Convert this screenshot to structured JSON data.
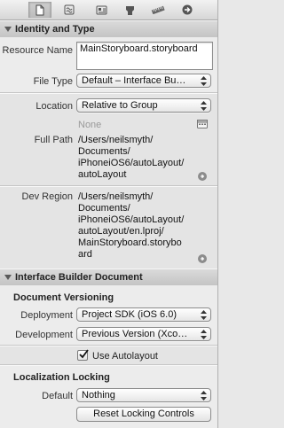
{
  "toolbar": {
    "icons": [
      "file-icon",
      "quick-help-icon",
      "identity-icon",
      "attributes-icon",
      "size-ruler-icon",
      "connections-arrow-icon"
    ]
  },
  "identity": {
    "title": "Identity and Type",
    "resource_name_label": "Resource Name",
    "resource_name_value": "MainStoryboard.storyboard",
    "file_type_label": "File Type",
    "file_type_value": "Default – Interface Bu…",
    "location_label": "Location",
    "location_value": "Relative to Group",
    "location_none": "None",
    "full_path_label": "Full Path",
    "full_path_value": [
      "/Users/neilsmyth/",
      "Documents/",
      "iPhoneiOS6/autoLayout/",
      "autoLayout"
    ],
    "dev_region_label": "Dev Region",
    "dev_region_value": [
      "/Users/neilsmyth/",
      "Documents/",
      "iPhoneiOS6/autoLayout/",
      "autoLayout/en.lproj/",
      "MainStoryboard.storybo",
      "ard"
    ]
  },
  "ibdoc": {
    "title": "Interface Builder Document",
    "versioning_heading": "Document Versioning",
    "deployment_label": "Deployment",
    "deployment_value": "Project SDK (iOS 6.0)",
    "development_label": "Development",
    "development_value": "Previous Version (Xco…",
    "autolayout_label": "Use Autolayout",
    "autolayout_checked": true,
    "localization_heading": "Localization Locking",
    "default_label": "Default",
    "default_value": "Nothing",
    "reset_button": "Reset Locking Controls"
  }
}
